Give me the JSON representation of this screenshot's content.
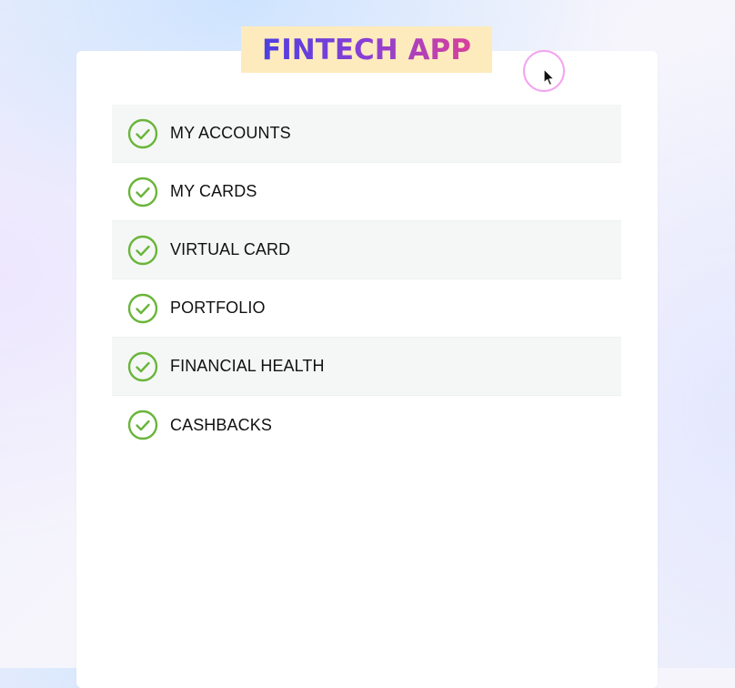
{
  "app": {
    "title": "FINTECH APP"
  },
  "features": {
    "items": [
      {
        "label": "MY ACCOUNTS",
        "icon": "check-circle-icon"
      },
      {
        "label": "MY CARDS",
        "icon": "check-circle-icon"
      },
      {
        "label": "VIRTUAL CARD",
        "icon": "check-circle-icon"
      },
      {
        "label": "PORTFOLIO",
        "icon": "check-circle-icon"
      },
      {
        "label": "FINANCIAL HEALTH",
        "icon": "check-circle-icon"
      },
      {
        "label": "CASHBACKS",
        "icon": "check-circle-icon"
      }
    ]
  },
  "colors": {
    "check": "#6ab53a",
    "title_badge_bg": "#fdebbd",
    "title_gradient_start": "#4d3fe0",
    "title_gradient_end": "#d8419c",
    "row_alt_bg": "#f5f7f6",
    "cursor_ring": "#f4a3f0"
  }
}
